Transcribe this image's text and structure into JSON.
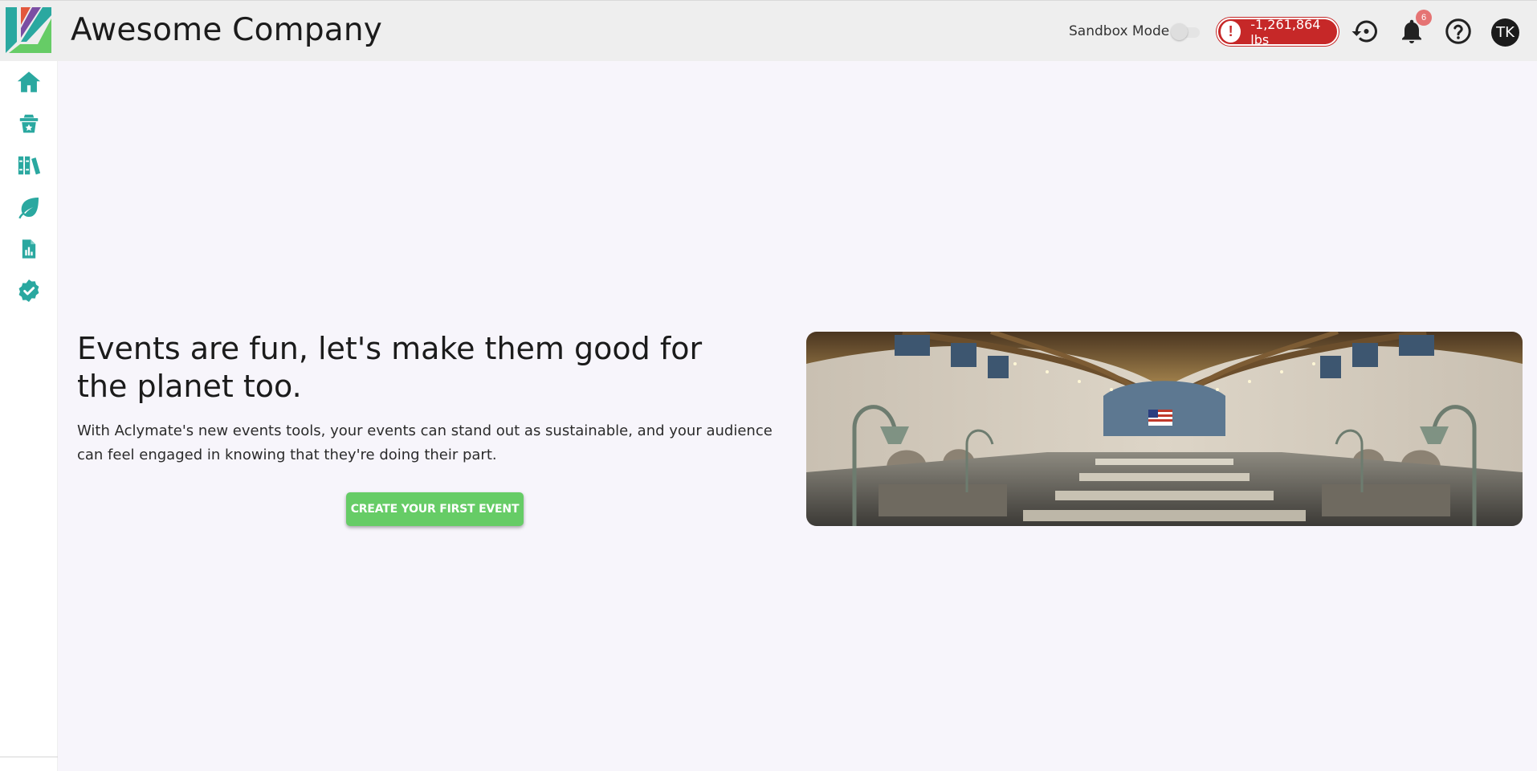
{
  "header": {
    "company_name": "Awesome Company",
    "sandbox_label": "Sandbox Mode",
    "sandbox_enabled": false,
    "emissions_amount": "-1,261,864 lbs",
    "emissions_alert_symbol": "!",
    "notification_count": "6",
    "avatar_initials": "TK",
    "icons": [
      "history-icon",
      "bell-icon",
      "help-icon"
    ]
  },
  "sidebar": {
    "items": [
      {
        "name": "home",
        "icon": "home-icon"
      },
      {
        "name": "offset-store",
        "icon": "shopping-bag-icon"
      },
      {
        "name": "library",
        "icon": "books-icon"
      },
      {
        "name": "sustainability",
        "icon": "leaf-icon"
      },
      {
        "name": "reports",
        "icon": "report-icon"
      },
      {
        "name": "verification",
        "icon": "verified-badge-icon"
      }
    ]
  },
  "main": {
    "title": "Events are fun, let's make them good for the planet too.",
    "body": "With Aclymate's new events tools, your events can stand out as sustainable, and your audience can feel engaged in knowing that they're doing their part.",
    "cta_label": "CREATE YOUR FIRST EVENT"
  },
  "colors": {
    "brand_teal": "#2aa8a0",
    "cta_green": "#66cc66",
    "alert_red": "#c62828",
    "notif_badge": "#e57373",
    "background": "#f7f5fb",
    "topbar": "#eeeeee"
  }
}
